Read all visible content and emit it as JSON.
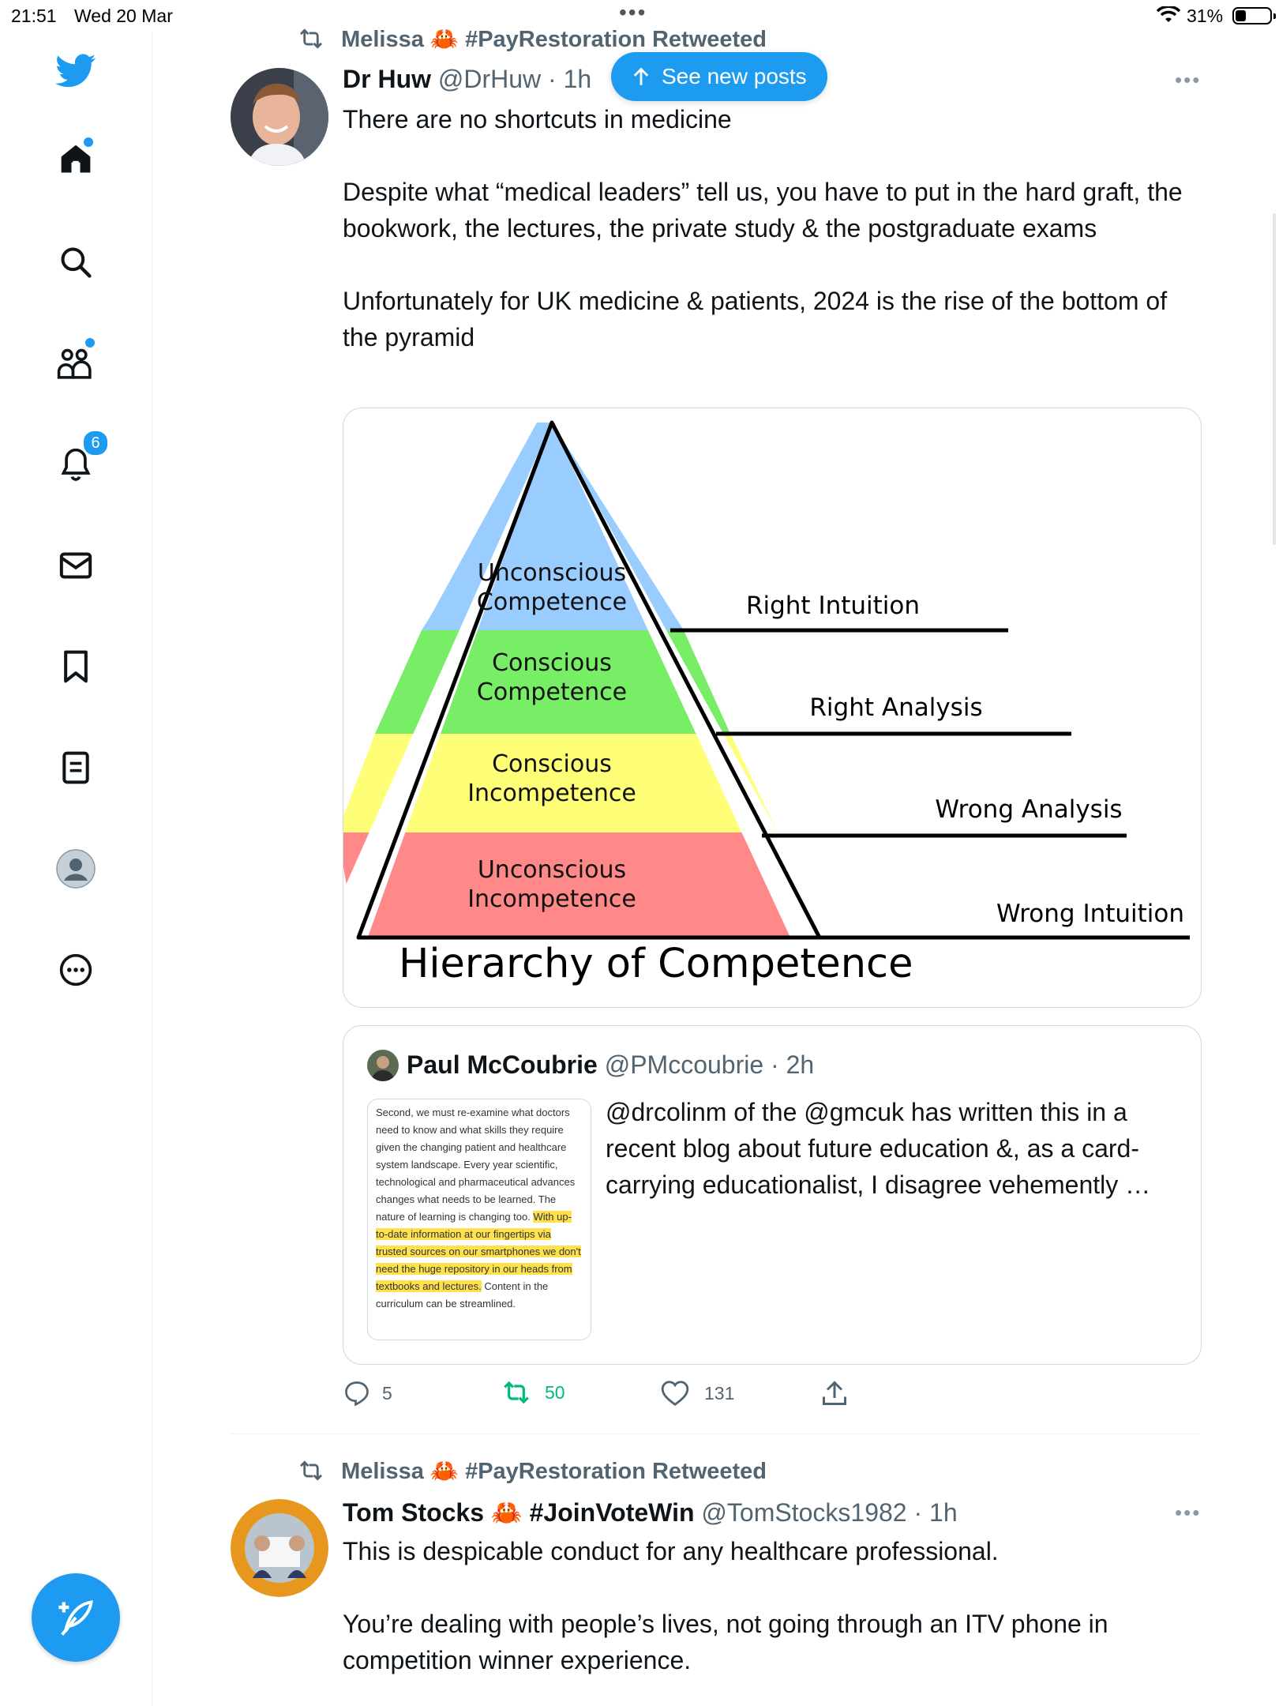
{
  "status_bar": {
    "time": "21:51",
    "date": "Wed 20 Mar",
    "battery": "31%",
    "battery_level": 0.31
  },
  "sidebar": {
    "items": [
      "logo",
      "home",
      "search",
      "communities",
      "notifications",
      "messages",
      "bookmarks",
      "lists",
      "profile",
      "more"
    ],
    "notification_count": "6"
  },
  "new_posts_pill": "See new posts",
  "tweet1": {
    "retweeted_by": "Melissa 🦀 #PayRestoration Retweeted",
    "author_name": "Dr Huw",
    "author_handle": "@DrHuw · 1h",
    "text": "There are no shortcuts in medicine\n\nDespite what “medical leaders” tell us, you have to put in the hard graft, the bookwork, the lectures, the private study & the postgraduate exams\n\nUnfortunately for UK medicine & patients, 2024 is the rise of the bottom of the pyramid",
    "image": {
      "title": "Hierarchy of Competence",
      "levels": [
        {
          "label_line1": "Unconscious",
          "label_line2": "Competence",
          "side": "Right Intuition",
          "color": "#99ccff"
        },
        {
          "label_line1": "Conscious",
          "label_line2": "Competence",
          "side": "Right Analysis",
          "color": "#77ee66"
        },
        {
          "label_line1": "Conscious",
          "label_line2": "Incompetence",
          "side": "Wrong Analysis",
          "color": "#ffff77"
        },
        {
          "label_line1": "Unconscious",
          "label_line2": "Incompetence",
          "side": "Wrong Intuition",
          "color": "#ff8888"
        }
      ]
    },
    "quote": {
      "author_name": "Paul McCoubrie",
      "author_handle": "@PMccoubrie · 2h",
      "text": "@drcolinm of the @gmcuk has written this in a recent blog about future education &, as a card-carrying educationalist, I disagree vehemently …",
      "thumb_plain": "Second, we must re-examine what doctors need to know and what skills they require given the changing patient and healthcare system landscape. Every year scientific, technological and pharmaceutical advances changes what needs to be learned. The nature of learning is changing too.",
      "thumb_highlight": "With up-to-date information at our fingertips via trusted sources on our smartphones we don't need the huge repository in our heads from textbooks and lectures.",
      "thumb_tail": "Content in the curriculum can be streamlined."
    },
    "actions": {
      "replies": "5",
      "retweets": "50",
      "likes": "131"
    }
  },
  "tweet2": {
    "retweeted_by": "Melissa 🦀 #PayRestoration Retweeted",
    "author_name": "Tom Stocks 🦀 #JoinVoteWin",
    "author_handle": "@TomStocks1982 · 1h",
    "text": "This is despicable conduct for any healthcare professional.\n\nYou’re dealing with people’s lives, not going through an ITV phone in competition winner experience."
  },
  "colors": {
    "accent": "#1d9bf0",
    "retweet_green": "#00ba7c",
    "secondary": "#536471"
  }
}
